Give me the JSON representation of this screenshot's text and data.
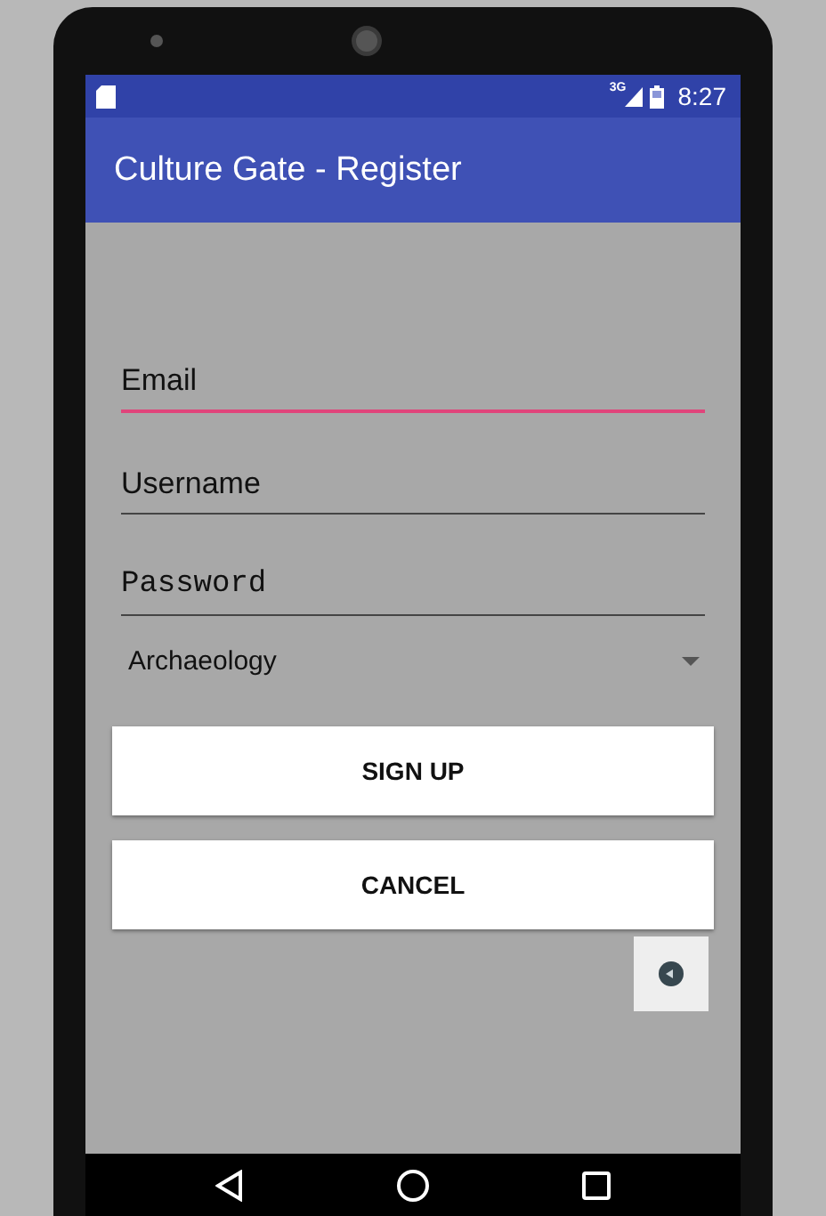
{
  "status_bar": {
    "network": "3G",
    "time": "8:27"
  },
  "app_bar": {
    "title": "Culture Gate - Register"
  },
  "fields": [
    {
      "kind": "text",
      "placeholder": "Email",
      "focused": true
    },
    {
      "kind": "text",
      "placeholder": "Username",
      "focused": false
    },
    {
      "kind": "password",
      "placeholder": "Password",
      "focused": false
    }
  ],
  "spinner": {
    "value": "Archaeology"
  },
  "buttons": [
    {
      "label": "SIGN UP"
    },
    {
      "label": "CANCEL"
    }
  ]
}
